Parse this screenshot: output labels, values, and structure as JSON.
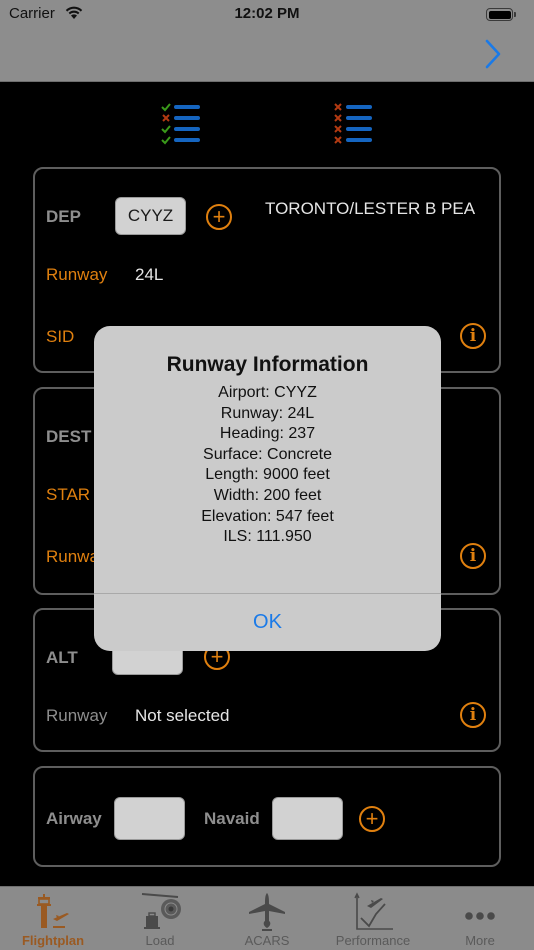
{
  "status_bar": {
    "carrier": "Carrier",
    "time": "12:02 PM",
    "wifi_icon": "wifi-icon",
    "battery_icon": "battery-icon"
  },
  "nav_bar": {
    "next_icon": "chevron-right-icon"
  },
  "toolbar": {
    "left_icon": "checklist-partial-icon",
    "right_icon": "checklist-cleared-icon"
  },
  "departure": {
    "label": "DEP",
    "airport_code": "CYYZ",
    "airport_name": "TORONTO/LESTER B PEA",
    "runway_label": "Runway",
    "runway_value": "24L",
    "sid_label": "SID",
    "sid_value": ""
  },
  "destination": {
    "label": "DEST",
    "airport_code": "",
    "star_label": "STAR",
    "runway_label": "Runway",
    "runway_value": ""
  },
  "alternate": {
    "label": "ALT",
    "airport_code": "",
    "runway_label": "Runway",
    "runway_value": "Not selected"
  },
  "route": {
    "airway_label": "Airway",
    "airway_value": "",
    "navaid_label": "Navaid",
    "navaid_value": ""
  },
  "alert": {
    "title": "Runway Information",
    "lines": [
      "Airport: CYYZ",
      "Runway: 24L",
      "Heading: 237",
      "Surface: Concrete",
      "Length: 9000 feet",
      "Width: 200 feet",
      "Elevation: 547 feet",
      "ILS: 111.950"
    ],
    "ok_label": "OK"
  },
  "tab_bar": {
    "active": "Flightplan",
    "tabs": [
      {
        "label": "Flightplan",
        "icon": "control-tower-departure-icon"
      },
      {
        "label": "Load",
        "icon": "baggage-engine-icon"
      },
      {
        "label": "ACARS",
        "icon": "airplane-icon"
      },
      {
        "label": "Performance",
        "icon": "performance-chart-icon"
      },
      {
        "label": "More",
        "icon": "more-dots-icon"
      }
    ]
  },
  "colors": {
    "accent_orange": "#e0800f",
    "link_blue": "#1a7ae8",
    "active_tab": "#9a5a22",
    "check_green": "#3a9a1a",
    "cross_red": "#b33a12",
    "list_blue": "#1565c0"
  }
}
